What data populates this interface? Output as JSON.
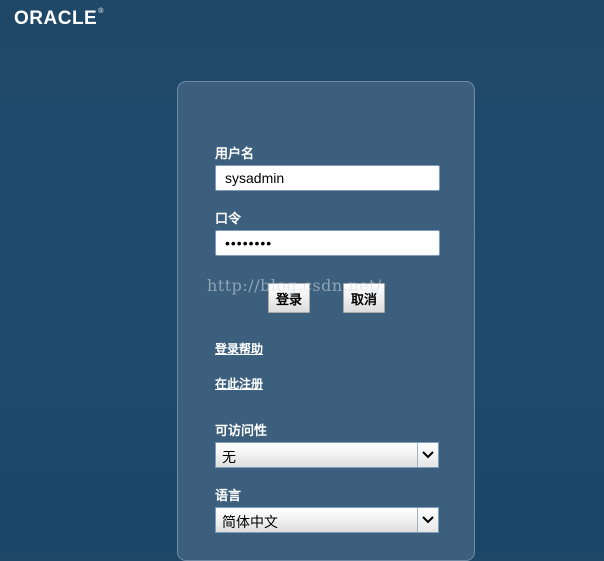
{
  "header": {
    "logo_text": "ORACLE",
    "logo_mark": "®"
  },
  "login": {
    "username_label": "用户名",
    "username_value": "sysadmin",
    "password_label": "口令",
    "password_value": "••••••••",
    "login_button": "登录",
    "cancel_button": "取消",
    "login_help_link": "登录帮助",
    "register_link": "在此注册",
    "accessibility_label": "可访问性",
    "accessibility_value": "无",
    "language_label": "语言",
    "language_value": "简体中文"
  },
  "watermark": "http://blog.csdn.net/"
}
